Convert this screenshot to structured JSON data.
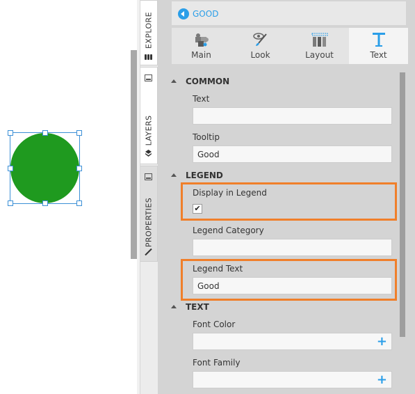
{
  "explorer_tabs": [
    {
      "label": "EXPLORE",
      "icon": "database-icon"
    },
    {
      "label": "LAYERS",
      "icon": "layers-icon"
    },
    {
      "label": "PROPERTIES",
      "icon": "brush-icon"
    }
  ],
  "header": {
    "title": "GOOD",
    "back_icon": "back-arrow-icon"
  },
  "subtabs": [
    {
      "label": "Main",
      "icon": "puzzle-icon"
    },
    {
      "label": "Look",
      "icon": "eye-brush-icon"
    },
    {
      "label": "Layout",
      "icon": "layout-icon"
    },
    {
      "label": "Text",
      "icon": "text-T-icon"
    }
  ],
  "sections": {
    "common": {
      "title": "COMMON",
      "text_label": "Text",
      "text_value": "",
      "tooltip_label": "Tooltip",
      "tooltip_value": "Good"
    },
    "legend": {
      "title": "LEGEND",
      "display_label": "Display in Legend",
      "display_checked": true,
      "checkmark": "✔",
      "category_label": "Legend Category",
      "category_value": "",
      "text_label": "Legend Text",
      "text_value": "Good"
    },
    "text": {
      "title": "TEXT",
      "font_color_label": "Font Color",
      "font_family_label": "Font Family",
      "add_symbol": "+"
    }
  },
  "colors": {
    "circle_fill": "#1f9a1f",
    "accent": "#2a9ee8",
    "highlight": "#f07f2a"
  }
}
